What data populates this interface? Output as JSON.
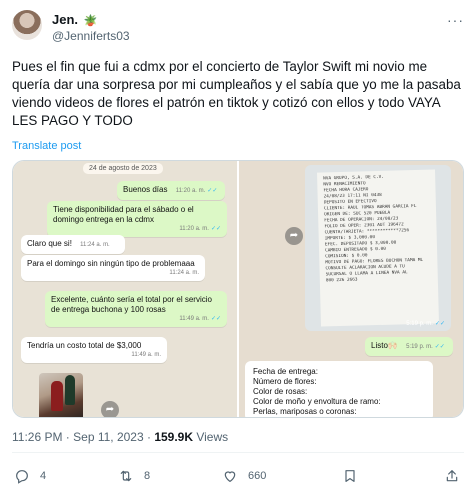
{
  "author": {
    "display_name": "Jen.",
    "name_emoji": "🪴",
    "handle": "@Jenniferts03"
  },
  "tweet": {
    "text": "Pues el fin que fui a cdmx por el concierto de Taylor Swift mi novio me quería dar una sorpresa por mi cumpleaños y el sabía que yo me la pasaba viendo videos de flores el patrón en tiktok y cotizó con ellos y todo VAYA LES PAGO Y TODO",
    "translate_label": "Translate post",
    "timestamp": "11:26 PM · Sep 11, 2023 · ",
    "views_count": "159.9K",
    "views_label": " Views"
  },
  "chat_left": {
    "date": "24 de agosto de 2023",
    "messages": [
      {
        "dir": "out",
        "text": "Buenos días",
        "time": "11:20 a. m."
      },
      {
        "dir": "out",
        "text": "Tiene disponibilidad para el sábado o el domingo entrega en la cdmx",
        "time": "11:20 a. m."
      },
      {
        "dir": "in",
        "text": "Claro que si!",
        "time": "11:24 a. m."
      },
      {
        "dir": "in",
        "text": "Para el domingo sin ningún tipo de problemaaa",
        "time": "11:24 a. m."
      },
      {
        "dir": "out",
        "text": "Excelente, cuánto sería el total  por el servicio de entrega buchona y 100 rosas",
        "time": "11:49 a. m."
      },
      {
        "dir": "in",
        "text": "Tendría un costo total de $3,000",
        "time": "11:49 a. m."
      }
    ]
  },
  "chat_right": {
    "receipt_lines": [
      "NVA GRUPO, S.A. DE C.V.",
      "NVO RENACIMIENTO",
      "",
      "FECHA     HORA    CAJERO",
      "24/08/23  17:11   NI  0438",
      "",
      "DEPOSITO EN EFECTIVO",
      "",
      "CLIENTE: RAUL TOMAS ABRAN GARCIA FL",
      "ORIGEN DE: SUC 520 PUEBLA",
      "FECHA DE OPERACION: 24/08/23",
      "FOLIO DE OPER: 2301  AUT 196472",
      "CUENTA/TARJETA: ************7256",
      "IMPORTE:           $  3,000.00",
      "EFEC. DEPOSITADO   $  3,000.00",
      "CAMBIO ENTREGADO   $      0.00",
      "COMISION:          $      0.00",
      "MOTIVO DE PAGO: FLORES BUCHON TAMA ML",
      "",
      "CONSULTE ACLARACION ACUDE A TU",
      "SUCURSAL O LLAMA A LINEA NVA AL",
      "800 226 2663"
    ],
    "receipt_time": "5:19 p. m.",
    "listo_text": "Listo🙌🏻",
    "listo_time": "5:19 p. m.",
    "form_lines": [
      "Fecha de entrega:",
      "Número de flores:",
      "Color de rosas:",
      "Color de moño y envoltura de ramo:",
      "Perlas, mariposas o coronas:"
    ]
  },
  "actions": {
    "replies": "4",
    "reposts": "8",
    "likes": "660"
  },
  "colors": {
    "accent": "#1d9bf0",
    "muted": "#536471",
    "outgoing_bubble": "#dcf8c6",
    "chat_bg": "#e8e2d6"
  }
}
